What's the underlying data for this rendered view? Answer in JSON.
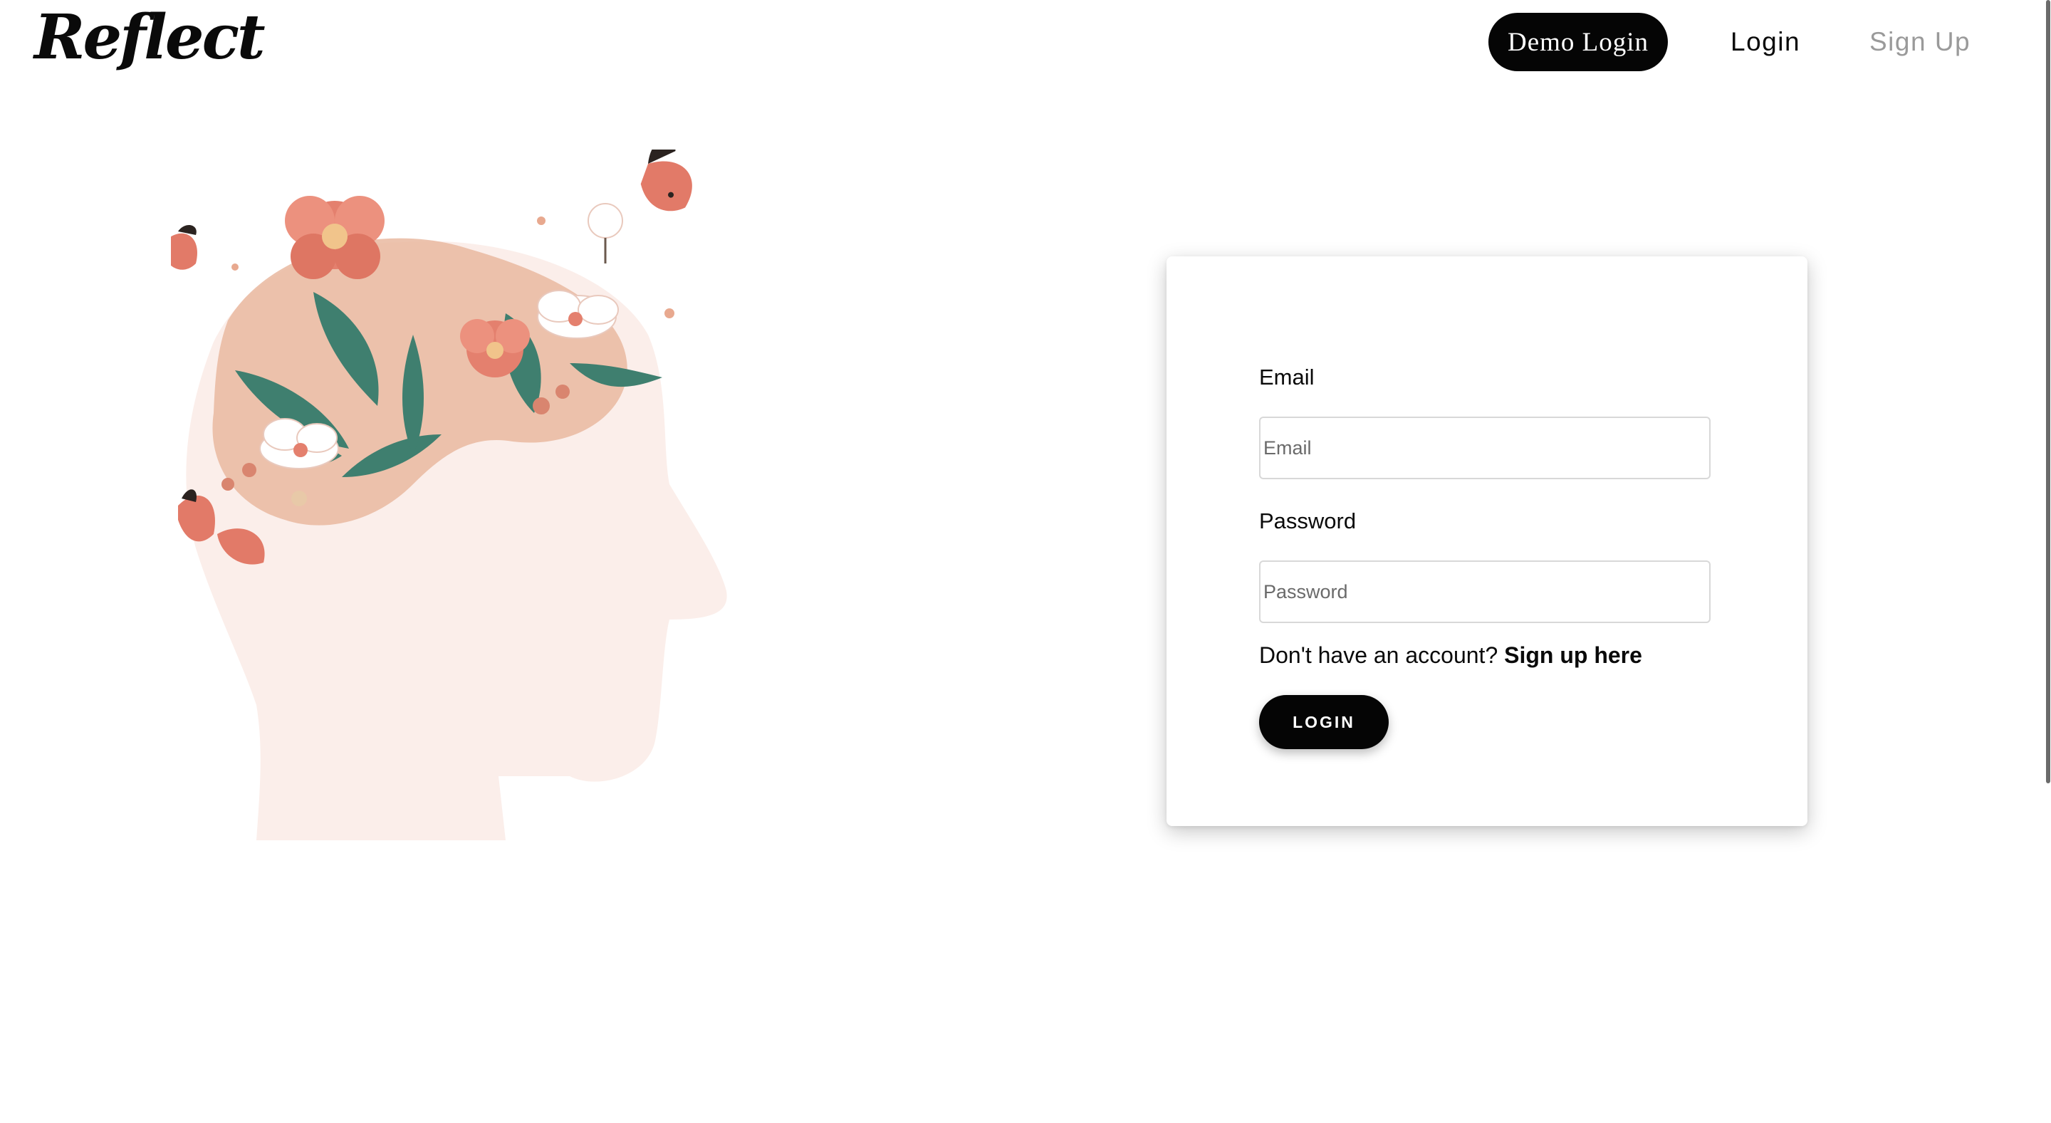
{
  "header": {
    "logo_text": "Reflect",
    "nav": {
      "demo_login_label": "Demo Login",
      "login_label": "Login",
      "signup_label": "Sign Up"
    }
  },
  "illustration": {
    "icon": "head-with-flowers-and-butterflies-illustration"
  },
  "login_form": {
    "email_label": "Email",
    "email_placeholder": "Email",
    "email_value": "",
    "password_label": "Password",
    "password_placeholder": "Password",
    "password_value": "",
    "signup_prompt": "Don't have an account?",
    "signup_link": "Sign up here",
    "submit_label": "LOGIN"
  },
  "colors": {
    "primary": "#050505",
    "muted_text": "#9a9a9a",
    "illustration_skin": "#fbeeea",
    "illustration_coral": "#e4806e",
    "illustration_green": "#3f7f6f"
  }
}
